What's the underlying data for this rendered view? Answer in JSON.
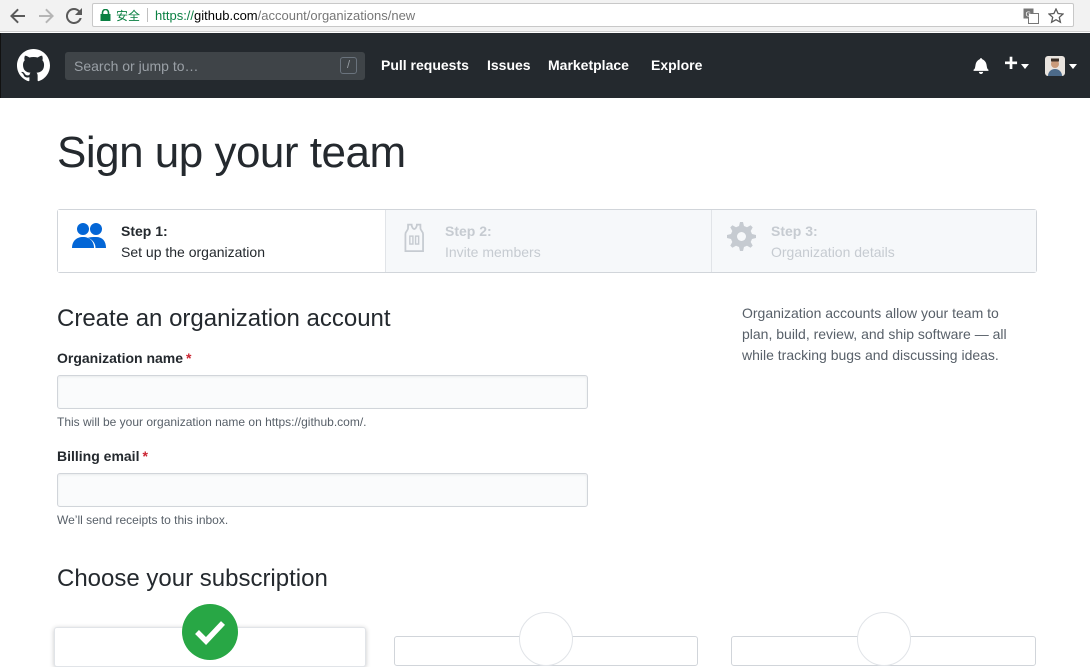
{
  "browser": {
    "secure_label": "安全",
    "url_scheme": "https://",
    "url_host": "github.com",
    "url_path": "/account/organizations/new"
  },
  "header": {
    "search_placeholder": "Search or jump to…",
    "search_shortcut": "/",
    "nav": [
      "Pull requests",
      "Issues",
      "Marketplace",
      "Explore"
    ],
    "new_label": "+"
  },
  "page": {
    "title": "Sign up your team"
  },
  "steps": [
    {
      "number": "Step 1:",
      "description": "Set up the organization",
      "icon": "people-icon",
      "active": true
    },
    {
      "number": "Step 2:",
      "description": "Invite members",
      "icon": "jersey-icon",
      "active": false
    },
    {
      "number": "Step 3:",
      "description": "Organization details",
      "icon": "gear-icon",
      "active": false
    }
  ],
  "form": {
    "heading": "Create an organization account",
    "org_name_label": "Organization name",
    "org_name_value": "",
    "org_name_hint": "This will be your organization name on https://github.com/.",
    "billing_email_label": "Billing email",
    "billing_email_value": "",
    "billing_email_hint": "We’ll send receipts to this inbox.",
    "required_marker": "*"
  },
  "aside": {
    "text": "Organization accounts allow your team to plan, build, review, and ship software — all while tracking bugs and discussing ideas."
  },
  "subscription": {
    "heading": "Choose your subscription"
  },
  "colors": {
    "header_bg": "#24292e",
    "required": "#cb2431",
    "active_step_icon": "#0366d6",
    "selected_plan": "#28a745"
  }
}
